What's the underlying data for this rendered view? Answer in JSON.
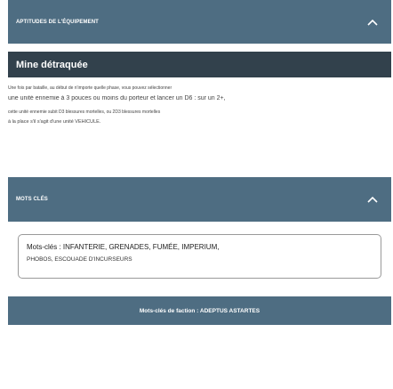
{
  "section_header": {
    "label": "APTITUDES DE L'ÉQUIPEMENT"
  },
  "ability": {
    "name": "Mine détraquée",
    "lines": [
      "Une fois par bataille, au début de n'importe quelle phase, vous pouvez sélectionner",
      "une unité ennemie à 3 pouces ou moins du porteur et lancer un D6 : sur un 2+,",
      "cette unité ennemie subit D3 blessures mortelles, ou 2D3 blessures mortelles",
      "à la place s'il s'agit d'une unité VÉHICULE."
    ]
  },
  "keywords_header": {
    "label": "MOTS CLÉS"
  },
  "keywords_box": {
    "line1": "Mots-clés : INFANTERIE, GRENADES, FUMÉE, IMPERIUM,",
    "line2": "PHOBOS, ESCOUADE D'INCURSEURS"
  },
  "faction_bar": {
    "label": "Mots-clés de faction : ADEPTUS ASTARTES"
  },
  "icons": {
    "collapse": "chevron-up-icon"
  },
  "colors": {
    "bar": "#4e6d82",
    "ability": "#32414c",
    "border": "#9a9a9a"
  }
}
